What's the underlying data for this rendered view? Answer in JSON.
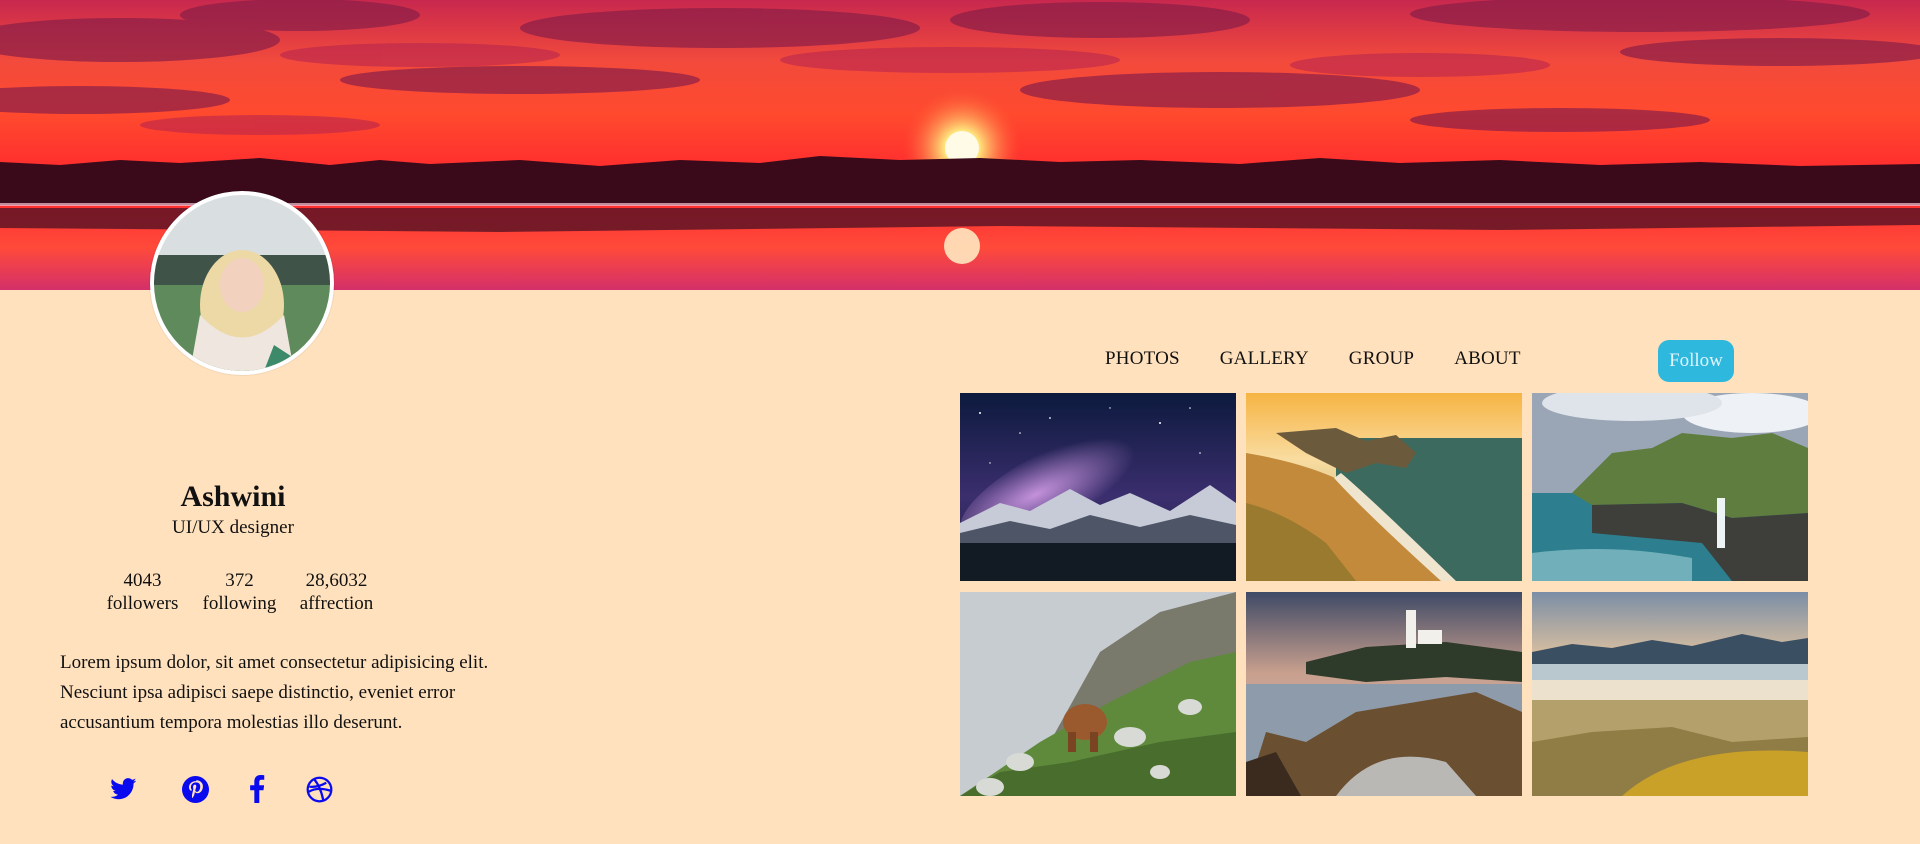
{
  "profile": {
    "name": "Ashwini",
    "role": "UI/UX designer",
    "stats": [
      {
        "value": "4043",
        "label": "followers"
      },
      {
        "value": "372",
        "label": "following"
      },
      {
        "value": "28,6032",
        "label": "affrection"
      }
    ],
    "bio": "Lorem ipsum dolor, sit amet consectetur adipisicing elit. Nesciunt ipsa adipisci saepe distinctio, eveniet error accusantium tempora molestias illo deserunt."
  },
  "nav": {
    "items": [
      "PHOTOS",
      "GALLERY",
      "GROUP",
      "ABOUT"
    ],
    "follow_label": "Follow"
  },
  "social": [
    "twitter-icon",
    "pinterest-icon",
    "facebook-icon",
    "dribbble-icon"
  ],
  "colors": {
    "page_background": "#ffe1bd",
    "follow_button": "#2fb8de",
    "social_icon": "#0a0aef"
  },
  "gallery": {
    "tiles": [
      {
        "subject": "milky-way-mountains"
      },
      {
        "subject": "coastal-arch-cliffs"
      },
      {
        "subject": "waterfall-sea-cliffs"
      },
      {
        "subject": "highland-cow-hillside"
      },
      {
        "subject": "lighthouse-rocky-coast"
      },
      {
        "subject": "beach-dunes-mountains"
      }
    ]
  }
}
